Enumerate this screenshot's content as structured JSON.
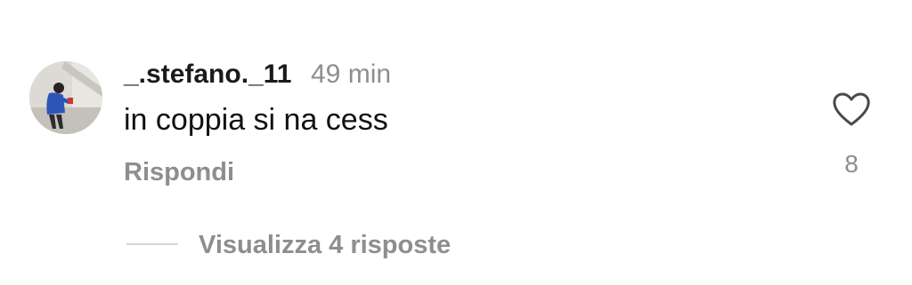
{
  "comment": {
    "username": "_.stefano._11",
    "timestamp": "49 min",
    "text": "in coppia si na cess",
    "reply_label": "Rispondi",
    "like_count": "8",
    "view_replies_label": "Visualizza 4 risposte",
    "like_icon": "heart-outline-icon"
  },
  "colors": {
    "primary_text": "#111111",
    "secondary_text": "#8e8e8e",
    "divider": "#d6d6d6",
    "background": "#ffffff"
  }
}
